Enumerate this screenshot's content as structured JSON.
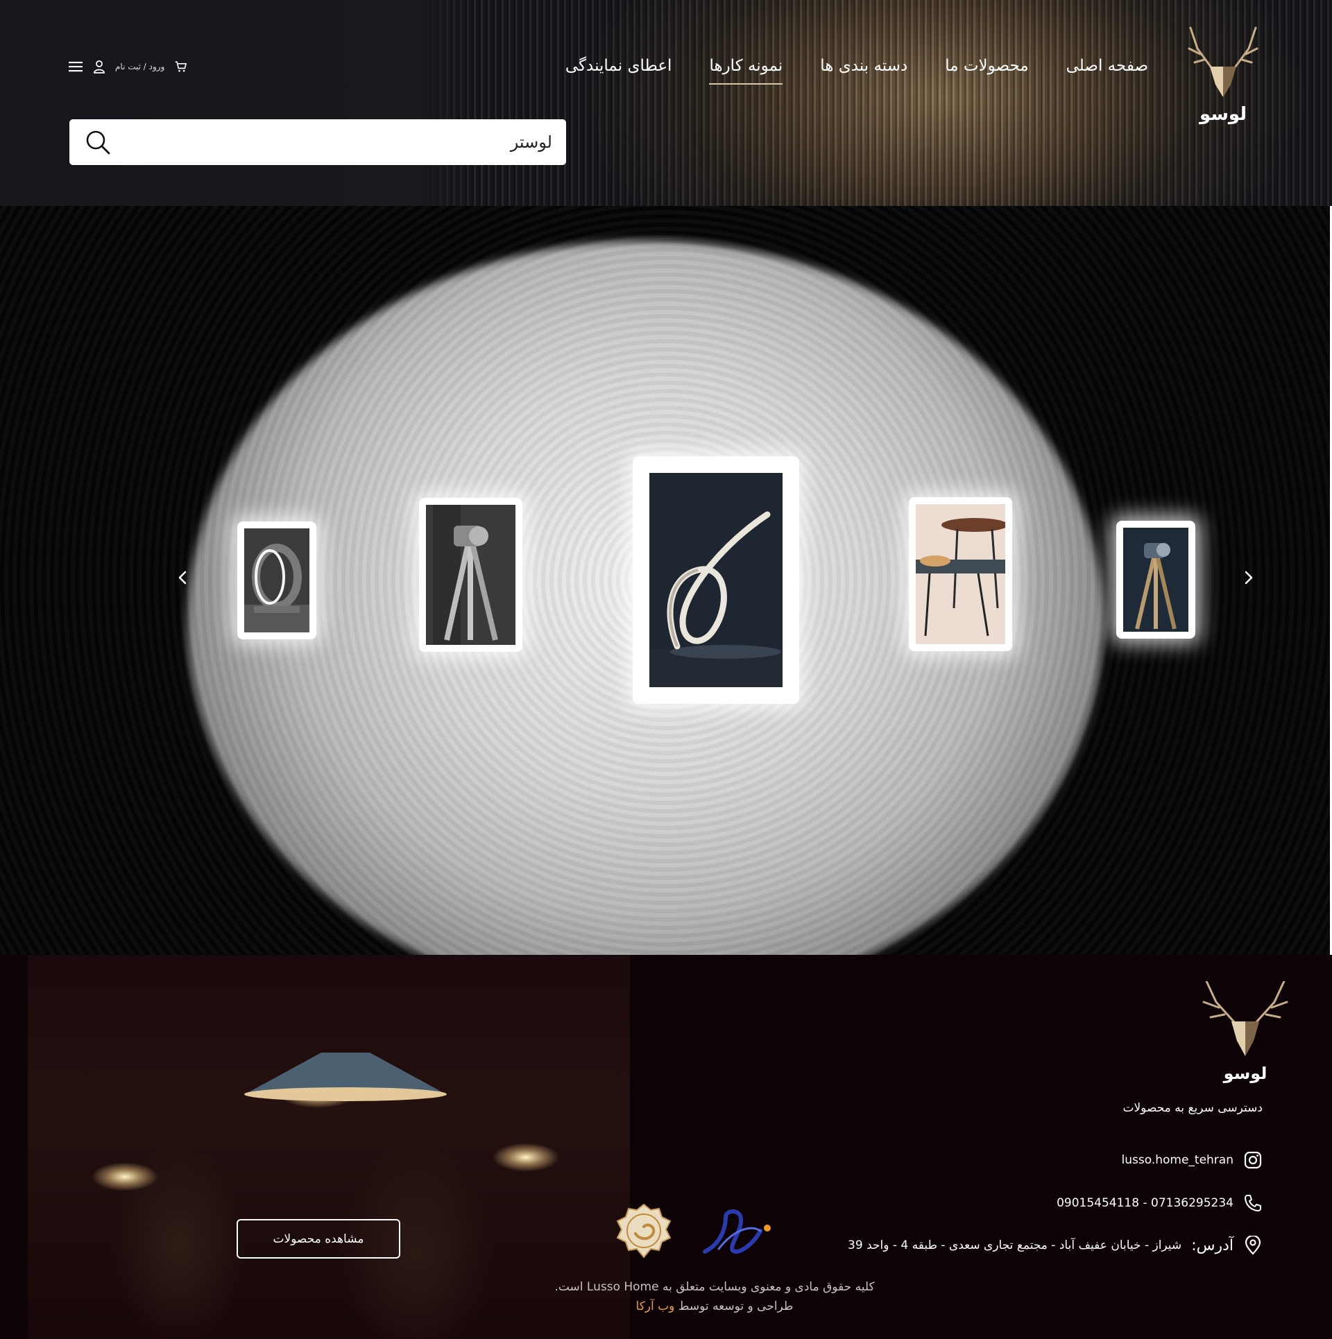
{
  "header": {
    "logo_text": "لوسو",
    "nav": [
      {
        "label": "صفحه اصلی",
        "active": false
      },
      {
        "label": "محصولات ما",
        "active": false
      },
      {
        "label": "دسته بندی ها",
        "active": false
      },
      {
        "label": "نمونه کارها",
        "active": true
      },
      {
        "label": "اعطای نمایندگی",
        "active": false
      }
    ],
    "login_label": "ورود / ثبت نام",
    "search": {
      "value": "لوستر"
    }
  },
  "hero": {
    "cards": [
      {
        "name": "ring-lamp",
        "icon": "ring-lamp-icon"
      },
      {
        "name": "tripod-lamp-grey",
        "icon": "tripod-lamp-icon"
      },
      {
        "name": "ribbon-led-lamp",
        "icon": "ribbon-lamp-icon"
      },
      {
        "name": "side-tables",
        "icon": "table-icon"
      },
      {
        "name": "tripod-lamp-blue",
        "icon": "tripod-lamp-icon"
      }
    ]
  },
  "footer": {
    "view_products_label": "مشاهده محصولات",
    "logo_text": "لوسو",
    "quick_access": "دسترسی سریع به محصولات",
    "instagram": "lusso.home_tehran",
    "phone": "07136295234 - 09015454118",
    "address_label": "آدرس:",
    "address": "شیراز - خیابان عفیف آباد - مجتمع تجاری سعدی - طبقه 4 - واحد 39",
    "copyright_line1": "کلیه حقوق مادی و معنوی وبسایت متعلق به Lusso Home است.",
    "copyright_prefix": "طراحی و توسعه توسط",
    "developer": "وب آرکا"
  },
  "colors": {
    "accent": "#e7a328",
    "header_dark": "#17171c",
    "footer_bg": "#0d0306",
    "nav_underline": "#d8c8a8"
  }
}
